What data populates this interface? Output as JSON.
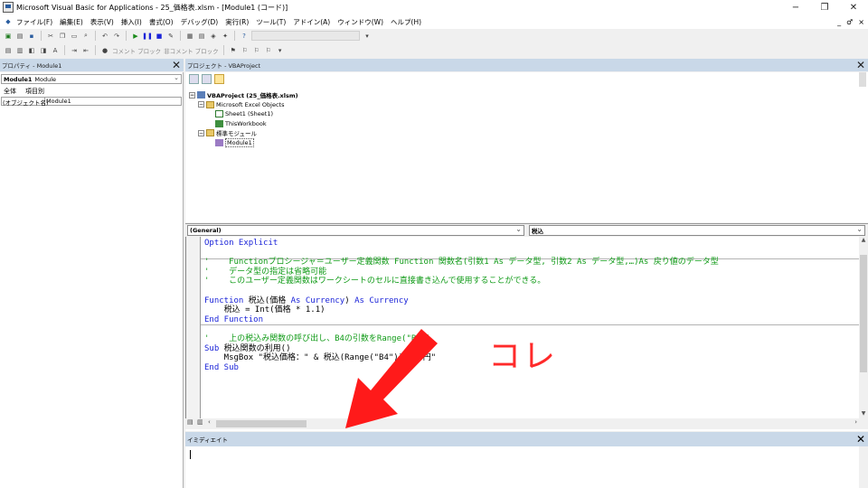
{
  "window": {
    "title": "Microsoft Visual Basic for Applications - 25_価格表.xlsm - [Module1 (コード)]",
    "controls": [
      "−",
      "❐",
      "✕"
    ]
  },
  "menu": {
    "items": [
      "ファイル(F)",
      "編集(E)",
      "表示(V)",
      "挿入(I)",
      "書式(O)",
      "デバッグ(D)",
      "実行(R)",
      "ツール(T)",
      "アドイン(A)",
      "ウィンドウ(W)",
      "ヘルプ(H)"
    ],
    "right_controls": [
      "_",
      "♂",
      "×"
    ]
  },
  "toolbar2": {
    "comment_block": "コメント ブロック",
    "uncomment_block": "非コメント ブロック"
  },
  "properties": {
    "header": "プロパティ - Module1",
    "object_name": "Module1",
    "object_type": "Module",
    "tabs": [
      "全体",
      "項目別"
    ],
    "row_key": "(オブジェクト名)",
    "row_value": "Module1"
  },
  "project": {
    "header": "プロジェクト - VBAProject",
    "tree": {
      "root": "VBAProject (25_価格表.xlsm)",
      "excel_objects": "Microsoft Excel Objects",
      "sheet1": "Sheet1 (Sheet1)",
      "thisworkbook": "ThisWorkbook",
      "std_modules": "標準モジュール",
      "module1": "Module1"
    }
  },
  "code": {
    "object_combo": "(General)",
    "proc_combo": "税込",
    "lines": [
      {
        "t": "kw",
        "s": "Option Explicit"
      },
      {
        "t": "tx",
        "s": ""
      },
      {
        "t": "cm",
        "s": "'    Functionプロシージャ＝ユーザー定義関数 Function 関数名(引数1 As データ型, 引数2 As データ型,…)As 戻り値のデータ型"
      },
      {
        "t": "cm",
        "s": "'    データ型の指定は省略可能"
      },
      {
        "t": "cm",
        "s": "'    このユーザー定義関数はワークシートのセルに直接書き込んで使用することができる。"
      },
      {
        "t": "tx",
        "s": ""
      },
      {
        "t": "fn1",
        "s": ""
      },
      {
        "t": "tx",
        "s": "    税込 = Int(価格 * 1.1)"
      },
      {
        "t": "kw",
        "s": "End Function"
      },
      {
        "t": "tx",
        "s": ""
      },
      {
        "t": "cm",
        "s": "'    上の税込み関数の呼び出し、B4の引数をRange(\"B4\")"
      },
      {
        "t": "sub1",
        "s": ""
      },
      {
        "t": "tx",
        "s": "    MsgBox \"税込価格：\" & 税込(Range(\"B4\")) & \"円\""
      },
      {
        "t": "kw",
        "s": "End Sub"
      }
    ],
    "function_line": {
      "kw1": "Function",
      "name": " 税込(価格 ",
      "kw2": "As Currency",
      "mid": ") ",
      "kw3": "As Currency"
    },
    "sub_line": {
      "kw": "Sub",
      "rest": " 税込関数の利用()"
    }
  },
  "immediate": {
    "header": "イミディエイト"
  },
  "annotation": {
    "text": "コレ",
    "color": "#ff2a2a"
  }
}
